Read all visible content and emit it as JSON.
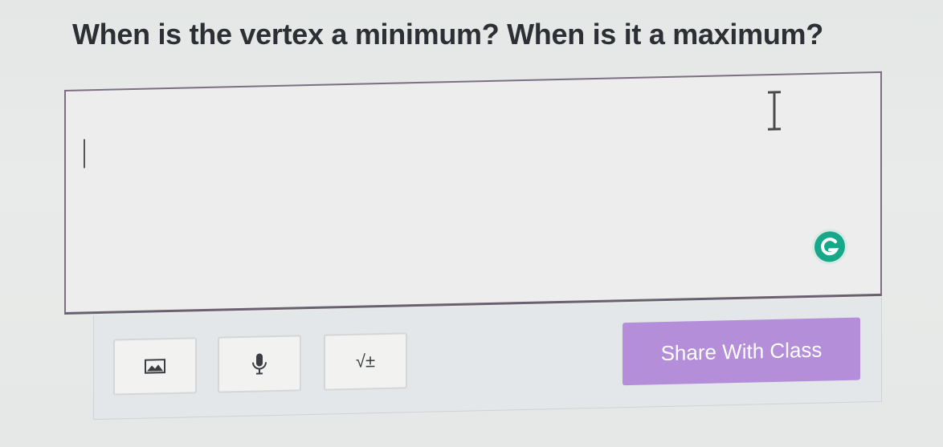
{
  "question": {
    "text": "When is the vertex a minimum? When is it a maximum?"
  },
  "answer": {
    "value": ""
  },
  "toolbar": {
    "image_icon": "image-icon",
    "mic_icon": "microphone-icon",
    "math_label": "√±",
    "share_label": "Share With Class"
  },
  "colors": {
    "share_button": "#b48ed9",
    "grammarly": "#17a88a",
    "box_border": "#7d6f82"
  }
}
